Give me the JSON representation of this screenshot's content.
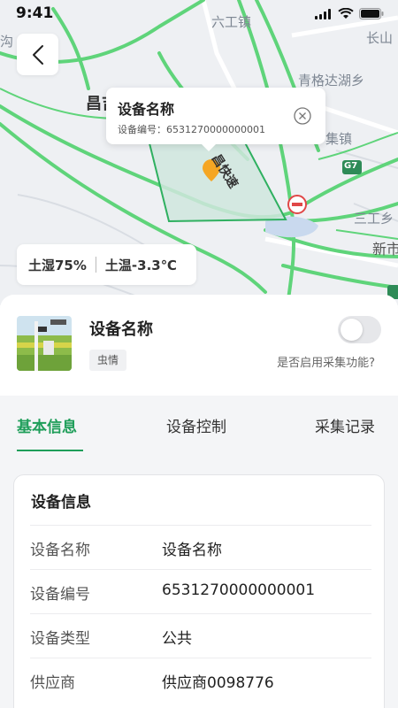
{
  "status_bar": {
    "time": "9:41"
  },
  "map": {
    "labels": {
      "town1": "六工镇",
      "town2": "长山",
      "town3": "青格达湖乡",
      "town4": "集镇",
      "town5": "三工乡",
      "town6": "新市",
      "city": "昌吉",
      "edge": "沟",
      "road_sign": "G7",
      "road_name": "昌快速"
    },
    "colors": {
      "road": "#5fd47a",
      "area_fill": "#cfe6dd",
      "area_stroke": "#2fb060",
      "marker": "#f5a623"
    }
  },
  "popup": {
    "title": "设备名称",
    "code": "设备编号：6531270000000001"
  },
  "soil": {
    "humidity": "土湿75%",
    "temperature": "土温-3.3℃"
  },
  "device": {
    "name": "设备名称",
    "tag": "虫情",
    "toggle_label": "是否启用采集功能?",
    "toggle_on": false
  },
  "tabs": [
    {
      "label": "基本信息",
      "active": true
    },
    {
      "label": "设备控制",
      "active": false
    },
    {
      "label": "采集记录",
      "active": false
    }
  ],
  "info": {
    "title": "设备信息",
    "rows": [
      {
        "key": "设备名称",
        "value": "设备名称"
      },
      {
        "key": "设备编号",
        "value": "6531270000000001"
      },
      {
        "key": "设备类型",
        "value": "公共"
      },
      {
        "key": "供应商",
        "value": "供应商0098776"
      }
    ]
  },
  "accent_color": "#1f9e5a"
}
